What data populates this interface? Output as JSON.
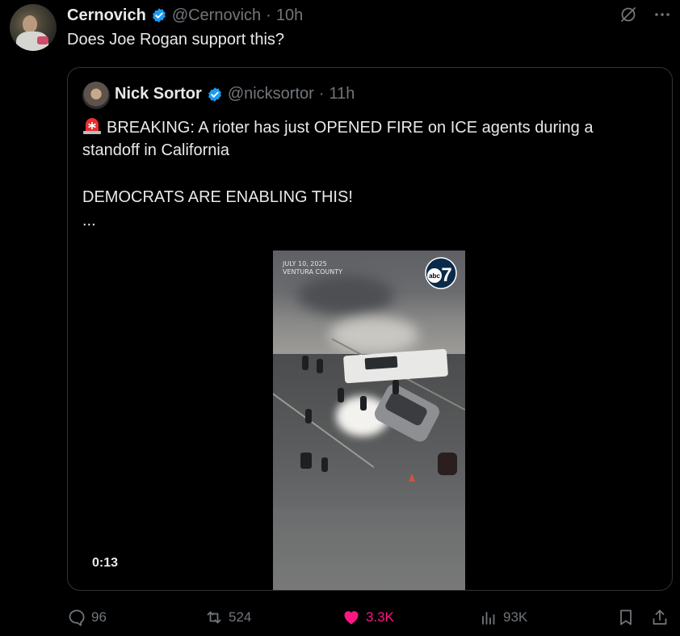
{
  "tweet": {
    "author_name": "Cernovich",
    "handle": "@Cernovich",
    "separator": "·",
    "time": "10h",
    "text": "Does Joe Rogan support this?"
  },
  "quote": {
    "author_name": "Nick Sortor",
    "handle": "@nicksortor",
    "separator": "·",
    "time": "11h",
    "line1": "BREAKING: A rioter has just OPENED FIRE on ICE agents during a",
    "line2": "standoff in California",
    "line3": "DEMOCRATS ARE ENABLING THIS!",
    "ellipsis": "...",
    "video": {
      "overlay_date": "JULY 10, 2025",
      "overlay_location": "VENTURA COUNTY",
      "logo_text": "abc",
      "logo_number": "7",
      "duration": "0:13"
    }
  },
  "actions": {
    "replies": "96",
    "reposts": "524",
    "likes": "3.3K",
    "views": "93K"
  },
  "colors": {
    "background": "#000000",
    "text": "#e7e9ea",
    "muted": "#71767b",
    "verified": "#1d9bf0",
    "like": "#f91880",
    "border": "#2f3336"
  }
}
